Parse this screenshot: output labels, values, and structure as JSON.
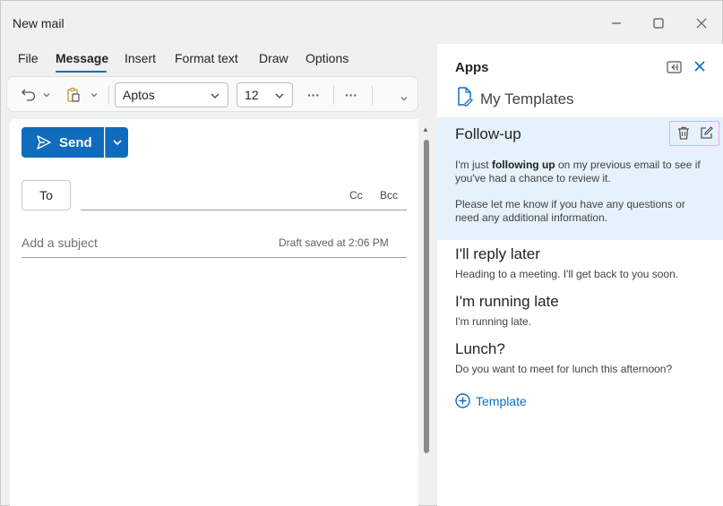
{
  "window": {
    "title": "New mail"
  },
  "tabs": [
    {
      "label": "File"
    },
    {
      "label": "Message"
    },
    {
      "label": "Insert"
    },
    {
      "label": "Format text"
    },
    {
      "label": "Draw"
    },
    {
      "label": "Options"
    }
  ],
  "ribbon": {
    "font": "Aptos",
    "size": "12",
    "more": "···"
  },
  "compose": {
    "send_label": "Send",
    "to_label": "To",
    "cc_label": "Cc",
    "bcc_label": "Bcc",
    "subject_placeholder": "Add a subject",
    "draft_status": "Draft saved at 2:06 PM"
  },
  "panel": {
    "title": "Apps",
    "app_name": "My Templates",
    "selected": {
      "title": "Follow-up",
      "body1_pre": "I'm just ",
      "body1_bold": "following up",
      "body1_post": " on my previous email to see if you've had a chance to review it.",
      "body2": "Please let me know if you have any questions or need any additional information."
    },
    "templates": [
      {
        "title": "I'll reply later",
        "desc": "Heading to a meeting. I'll get back to you soon."
      },
      {
        "title": "I'm running late",
        "desc": "I'm running late."
      },
      {
        "title": "Lunch?",
        "desc": "Do you want to meet for lunch this afternoon?"
      }
    ],
    "add_label": "Template"
  },
  "colors": {
    "accent": "#0f6cbd",
    "selected_bg": "#e5f1fb",
    "highlight_border": "#f3a5e8"
  }
}
